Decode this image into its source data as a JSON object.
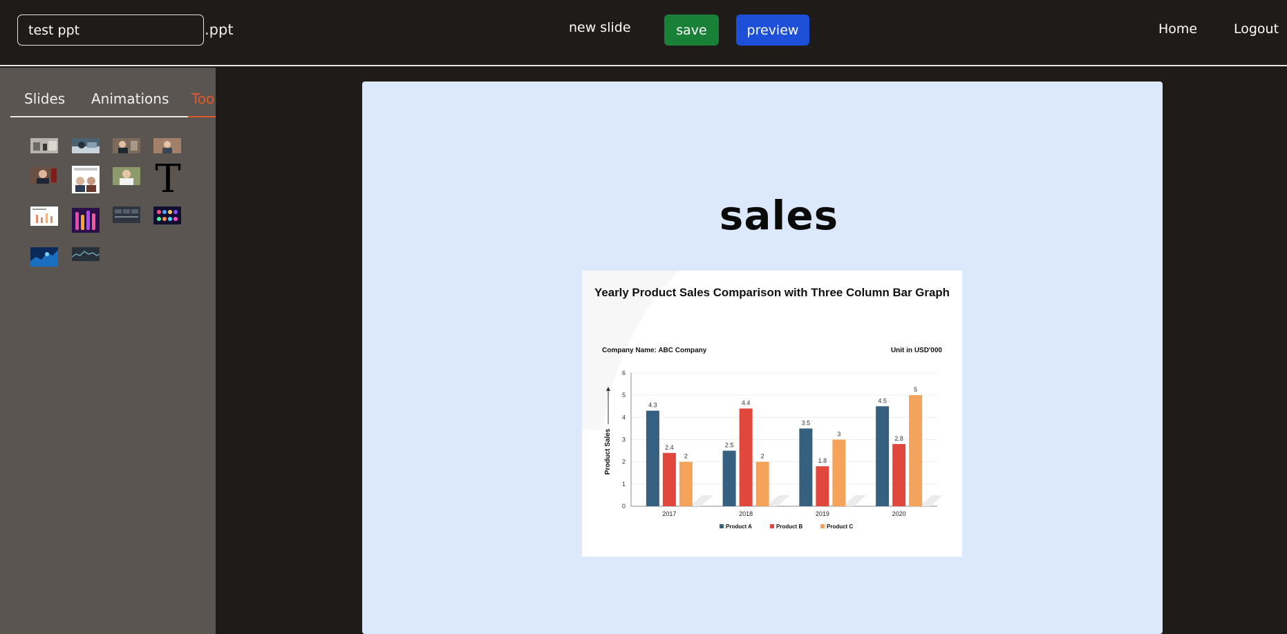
{
  "header": {
    "filename_value": "test ppt",
    "extension": ".ppt",
    "new_slide_label": "new slide",
    "save_label": "save",
    "preview_label": "preview",
    "home_label": "Home",
    "logout_label": "Logout"
  },
  "sidebar": {
    "tabs": [
      {
        "label": "Slides"
      },
      {
        "label": "Animations"
      },
      {
        "label": "Toolbox",
        "active": true
      }
    ],
    "text_tool_glyph": "T"
  },
  "slide": {
    "title": "sales",
    "background": "#dce9fc"
  },
  "colors": {
    "save": "#198038",
    "preview": "#1d4fd8",
    "active_tab": "#e0592a",
    "product_a": "#35607f",
    "product_b": "#e2473e",
    "product_c": "#f3a45a"
  },
  "chart_data": {
    "type": "bar",
    "title": "Yearly Product Sales Comparison with Three Column Bar Graph",
    "company_label": "Company Name: ABC Company",
    "unit_label": "Unit in USD'000",
    "ylabel": "Product Sales",
    "categories": [
      "2017",
      "2018",
      "2019",
      "2020"
    ],
    "ylim": [
      0,
      6
    ],
    "yticks": [
      "0",
      "1",
      "2",
      "3",
      "4",
      "5",
      "6"
    ],
    "series": [
      {
        "name": "Product A",
        "values": [
          4.3,
          2.5,
          3.5,
          4.5
        ]
      },
      {
        "name": "Product B",
        "values": [
          2.4,
          4.4,
          1.8,
          2.8
        ]
      },
      {
        "name": "Product C",
        "values": [
          2,
          2,
          3,
          5
        ]
      }
    ],
    "legend_position": "bottom"
  }
}
